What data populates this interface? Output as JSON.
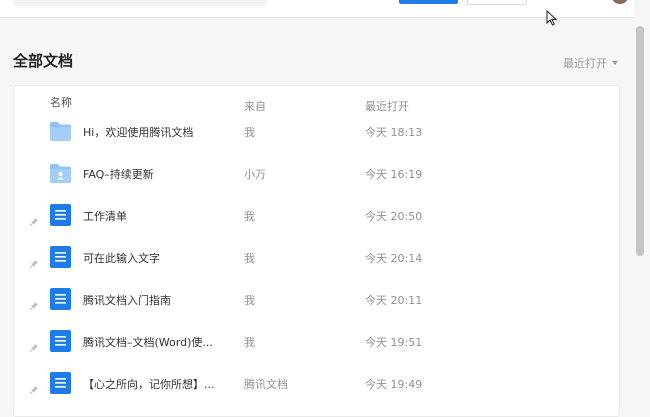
{
  "section_title": "全部文档",
  "sort_label": "最近打开",
  "table": {
    "headers": {
      "name": "名称",
      "from": "来自",
      "time": "最近打开"
    }
  },
  "rows": [
    {
      "title": "Hi，欢迎使用腾讯文档",
      "from": "我",
      "time": "今天 18:13",
      "icon": "folder-icon",
      "pinned": false
    },
    {
      "title": "FAQ–持续更新",
      "from": "小万",
      "time": "今天 16:19",
      "icon": "shared-folder-icon",
      "pinned": false
    },
    {
      "title": "工作清单",
      "from": "我",
      "time": "今天 20:50",
      "icon": "doc-icon",
      "pinned": true
    },
    {
      "title": "可在此输入文字",
      "from": "我",
      "time": "今天 20:14",
      "icon": "doc-icon",
      "pinned": true
    },
    {
      "title": "腾讯文档入门指南",
      "from": "我",
      "time": "今天 20:11",
      "icon": "doc-icon",
      "pinned": true
    },
    {
      "title": "腾讯文档–文档(Word)使...",
      "from": "我",
      "time": "今天 19:51",
      "icon": "doc-icon",
      "pinned": true
    },
    {
      "title": "【心之所向，记你所想】...",
      "from": "腾讯文档",
      "time": "今天 19:49",
      "icon": "doc-icon",
      "pinned": true
    }
  ],
  "colors": {
    "primary": "#1e7ce8",
    "folder": "#8fc3f5",
    "doc": "#1e7ce8"
  }
}
